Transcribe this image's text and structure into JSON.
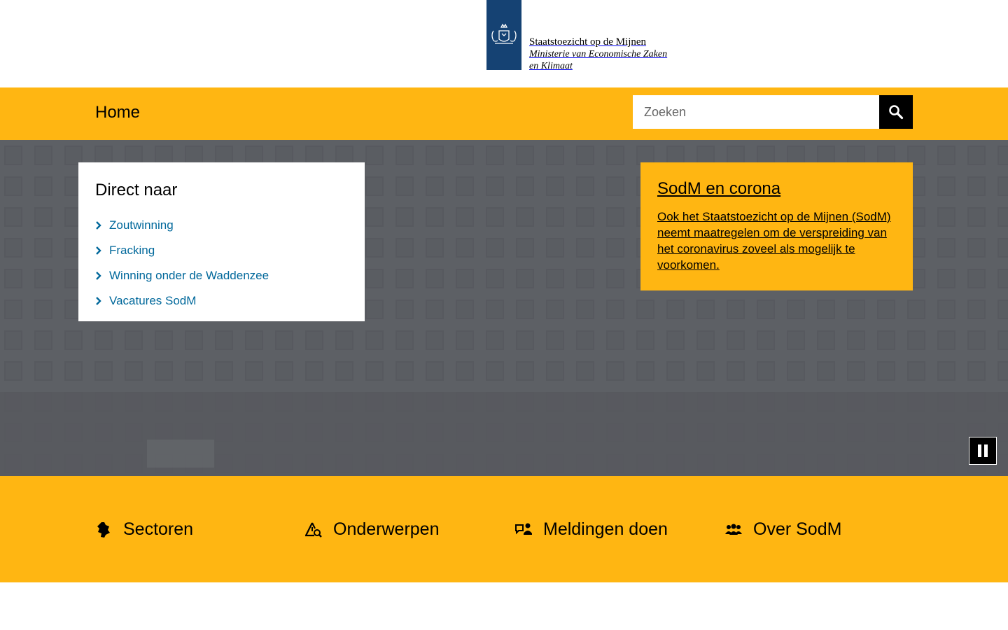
{
  "header": {
    "logo_line1": "Staatstoezicht op de Mijnen",
    "logo_line2": "Ministerie van Economische Zaken",
    "logo_line3": "en Klimaat",
    "logo_icon": "rijkswapen-icon",
    "brand_color": "#154273"
  },
  "nav": {
    "home_label": "Home",
    "search_placeholder": "Zoeken",
    "search_value": "",
    "search_icon": "search-icon",
    "accent_color": "#ffb612"
  },
  "hero": {
    "direct": {
      "title": "Direct naar",
      "items": [
        {
          "label": "Zoutwinning"
        },
        {
          "label": "Fracking"
        },
        {
          "label": "Winning onder de Waddenzee"
        },
        {
          "label": "Vacatures SodM"
        }
      ]
    },
    "corona": {
      "title": "SodM en corona",
      "text": "Ook het Staatstoezicht op de Mijnen (SodM) neemt maatregelen om de verspreiding van het coronavirus zoveel als mogelijk te voorkomen."
    },
    "pause_icon": "pause-icon"
  },
  "bottom_nav": {
    "items": [
      {
        "label": "Sectoren",
        "icon": "sectoren-icon"
      },
      {
        "label": "Onderwerpen",
        "icon": "onderwerpen-icon"
      },
      {
        "label": "Meldingen doen",
        "icon": "meldingen-icon"
      },
      {
        "label": "Over SodM",
        "icon": "people-icon"
      }
    ]
  }
}
